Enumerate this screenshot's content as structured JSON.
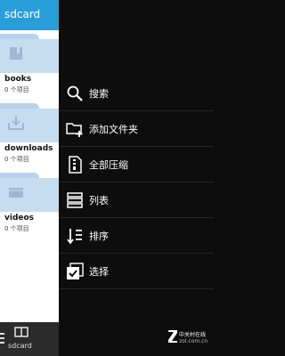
{
  "header": {
    "title": "sdcard"
  },
  "folders": [
    {
      "name": "books",
      "count": "0 个项目"
    },
    {
      "name": "downloads",
      "count": "0 个项目"
    },
    {
      "name": "videos",
      "count": "0 个项目"
    }
  ],
  "bottom_bar": {
    "label": "sdcard"
  },
  "menu": {
    "items": [
      {
        "label": "搜索",
        "icon": "search-icon"
      },
      {
        "label": "添加文件夹",
        "icon": "add-folder-icon"
      },
      {
        "label": "全部压缩",
        "icon": "zip-icon"
      },
      {
        "label": "列表",
        "icon": "list-icon"
      },
      {
        "label": "排序",
        "icon": "sort-icon"
      },
      {
        "label": "选择",
        "icon": "select-icon"
      }
    ]
  },
  "watermark": {
    "main": "中关村在线",
    "sub": "zol.com.cn"
  },
  "colors": {
    "accent": "#2a9ed8",
    "menu_bg": "#0d0d0d",
    "folder": "#c6dcf0"
  }
}
